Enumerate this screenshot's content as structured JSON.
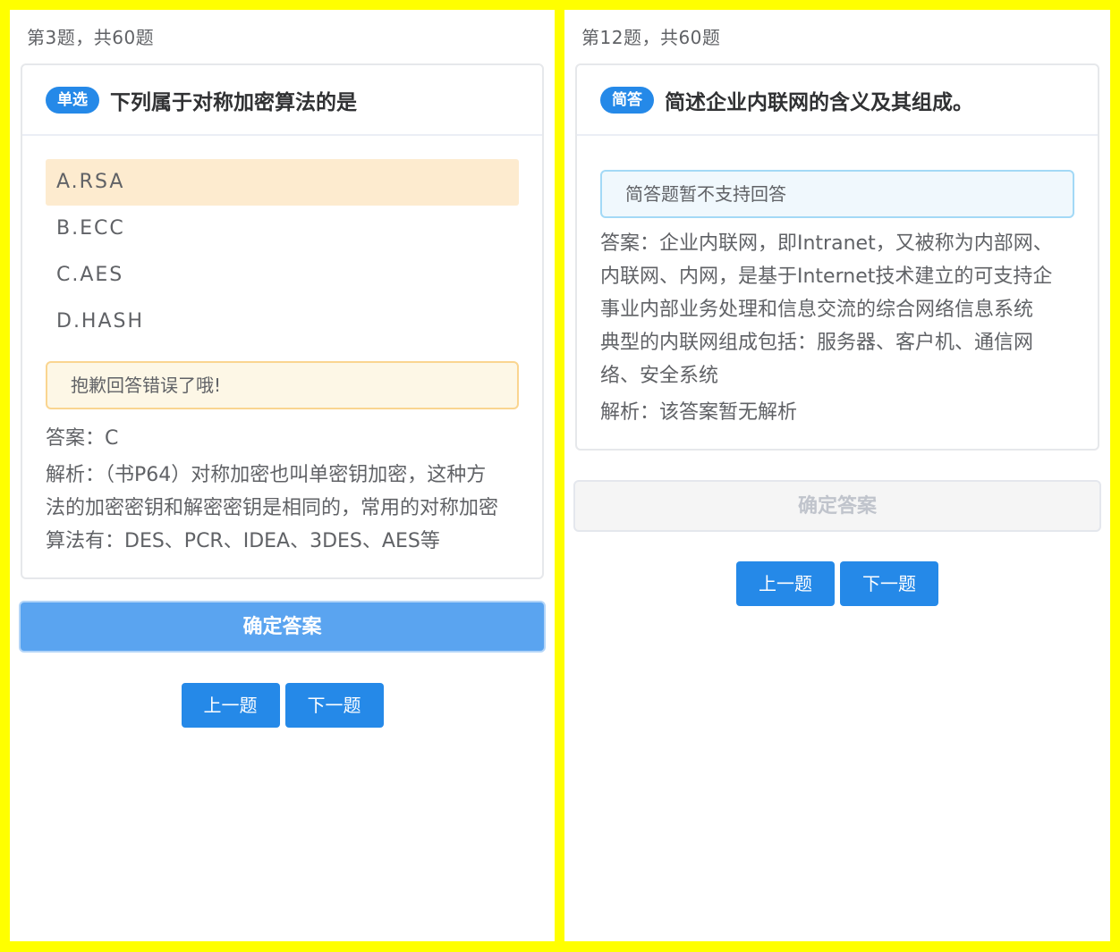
{
  "left": {
    "counter": "第3题，共60题",
    "question": {
      "type_badge": "单选",
      "title": "下列属于对称加密算法的是",
      "options": [
        {
          "label": "A.RSA",
          "selected": true
        },
        {
          "label": "B.ECC",
          "selected": false
        },
        {
          "label": "C.AES",
          "selected": false
        },
        {
          "label": "D.HASH",
          "selected": false
        }
      ],
      "feedback": "抱歉回答错误了哦!",
      "answer": "答案：C",
      "analysis_lines": [
        "解析：（书P64）对称加密也叫单密钥加密，这种方",
        "法的加密密钥和解密密钥是相同的，常用的对称加密",
        "算法有：DES、PCR、IDEA、3DES、AES等"
      ]
    },
    "confirm_label": "确定答案",
    "prev_label": "上一题",
    "next_label": "下一题"
  },
  "right": {
    "counter": "第12题，共60题",
    "question": {
      "type_badge": "简答",
      "title": "简述企业内联网的含义及其组成。",
      "notice": "简答题暂不支持回答",
      "answer_lines": [
        "答案：企业内联网，即Intranet，又被称为内部网、",
        "内联网、内网，是基于Internet技术建立的可支持企",
        "事业内部业务处理和信息交流的综合网络信息系统",
        "典型的内联网组成包括：服务器、客户机、通信网",
        "络、安全系统"
      ],
      "analysis": "解析：该答案暂无解析"
    },
    "confirm_label": "确定答案",
    "prev_label": "上一题",
    "next_label": "下一题"
  },
  "colors": {
    "frame": "#ffff00",
    "primary": "#2589e8",
    "selected_option_bg": "#fdebcf",
    "warning_border": "#fad590",
    "info_border": "#a3d9f6"
  }
}
